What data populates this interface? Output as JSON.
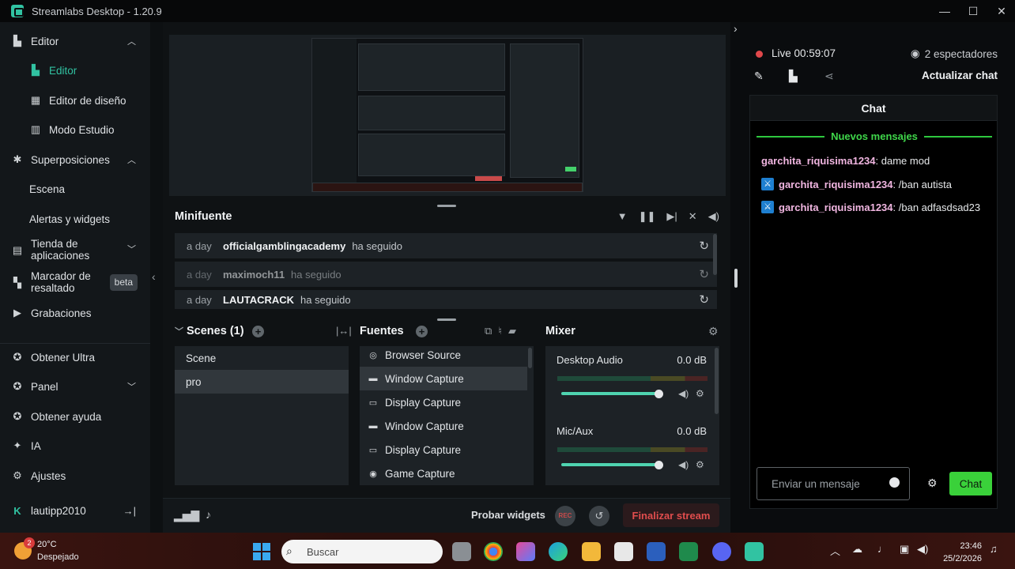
{
  "window": {
    "title": "Streamlabs Desktop - 1.20.9",
    "controls": [
      "minimize-icon",
      "maximize-icon",
      "close-icon"
    ]
  },
  "sidebar": {
    "editor": "Editor",
    "editor_sub": "Editor",
    "layout_editor": "Editor de diseño",
    "studio_mode": "Modo Estudio",
    "overlays": "Superposiciones",
    "scene": "Escena",
    "alerts": "Alertas y widgets",
    "app_store": "Tienda de aplicaciones",
    "highlighter": "Marcador de resaltado",
    "beta": "beta",
    "recordings": "Grabaciones",
    "ultra": "Obtener Ultra",
    "panel": "Panel",
    "help": "Obtener ayuda",
    "ai": "IA",
    "settings": "Ajustes",
    "user": "lautipp2010"
  },
  "minifuente": {
    "title": "Minifuente",
    "events": [
      {
        "time": "a day",
        "user": "officialgamblingacademy",
        "action": "ha seguido"
      },
      {
        "time": "a day",
        "user": "maximoch11",
        "action": "ha seguido"
      },
      {
        "time": "a day",
        "user": "LAUTACRACK",
        "action": "ha seguido"
      }
    ]
  },
  "scenes": {
    "title": "Scenes (1)",
    "items": [
      "Scene",
      "pro"
    ]
  },
  "sources": {
    "title": "Fuentes",
    "items": [
      {
        "label": "Browser Source",
        "icon": "globe-icon"
      },
      {
        "label": "Window Capture",
        "icon": "window-icon"
      },
      {
        "label": "Display Capture",
        "icon": "monitor-icon"
      },
      {
        "label": "Window Capture",
        "icon": "window-icon"
      },
      {
        "label": "Display Capture",
        "icon": "monitor-icon"
      },
      {
        "label": "Game Capture",
        "icon": "gamepad-icon"
      }
    ]
  },
  "mixer": {
    "title": "Mixer",
    "channels": [
      {
        "name": "Desktop Audio",
        "db": "0.0 dB"
      },
      {
        "name": "Mic/Aux",
        "db": "0.0 dB"
      }
    ]
  },
  "footer": {
    "test_widgets": "Probar widgets",
    "rec": "REC",
    "end_stream": "Finalizar stream"
  },
  "live": {
    "status": "Live 00:59:07",
    "viewers": "2 espectadores",
    "update_chat": "Actualizar chat"
  },
  "chat": {
    "title": "Chat",
    "new_messages": "Nuevos mensajes",
    "messages": [
      {
        "user": "garchita_riquisima1234",
        "text": ": dame mod"
      },
      {
        "user": "garchita_riquisima1234",
        "text": ": /ban autista"
      },
      {
        "user": "garchita_riquisima1234",
        "text": ": /ban adfasdsad23"
      }
    ],
    "placeholder": "Enviar un mensaje",
    "send": "Chat"
  },
  "taskbar": {
    "weather_badge": "2",
    "temperature": "20°C",
    "condition": "Despejado",
    "search": "Buscar",
    "time": "23:46",
    "date": "25/2/2026"
  },
  "colors": {
    "accent": "#31c3a2",
    "live": "#e0484b",
    "chat_green": "#3ad13a",
    "end_stream": "#e04d4d"
  }
}
